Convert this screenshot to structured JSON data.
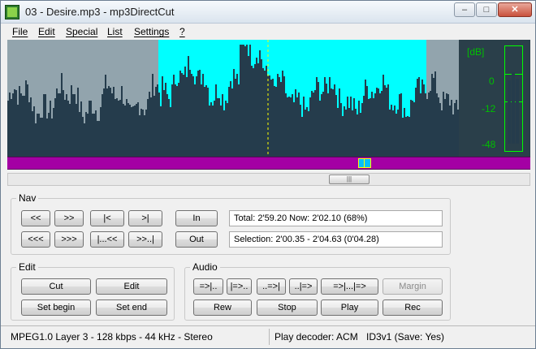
{
  "window": {
    "title": "03 - Desire.mp3 - mp3DirectCut"
  },
  "titlebar_buttons": {
    "minimize": "–",
    "maximize": "□",
    "close": "✕"
  },
  "menu": [
    "File",
    "Edit",
    "Special",
    "List",
    "Settings",
    "?"
  ],
  "meter": {
    "db_label": "[dB]",
    "ticks": [
      "0",
      "-12",
      "-48"
    ]
  },
  "colors": {
    "selection": "#00ffff",
    "wave": "#253c4c",
    "background": "#92a4ad",
    "overview": "#a400a4",
    "meter": "#00ff00"
  },
  "nav": {
    "label": "Nav",
    "row1": [
      "<<",
      ">>",
      "|<",
      ">|"
    ],
    "row2": [
      "<<<",
      ">>>",
      "|...<<",
      ">>..|"
    ],
    "in_button": "In",
    "out_button": "Out",
    "time_info": "Total: 2'59.20   Now: 2'02.10   (68%)",
    "selection_info": "Selection: 2'00.35 - 2'04.63 (0'04.28)"
  },
  "edit": {
    "label": "Edit",
    "cut": "Cut",
    "edit": "Edit",
    "set_begin": "Set begin",
    "set_end": "Set end"
  },
  "audio": {
    "label": "Audio",
    "row1": [
      "=>|..",
      "|=>..",
      "..=>|",
      "..|=>",
      "=>|...|=>"
    ],
    "margin": "Margin",
    "rew": "Rew",
    "stop": "Stop",
    "play": "Play",
    "rec": "Rec"
  },
  "status": {
    "format": "MPEG1.0 Layer 3 - 128 kbps - 44 kHz - Stereo",
    "decoder": "Play decoder: ACM",
    "tag": "ID3v1 (Save: Yes)"
  },
  "scroll_thumb": "|||"
}
